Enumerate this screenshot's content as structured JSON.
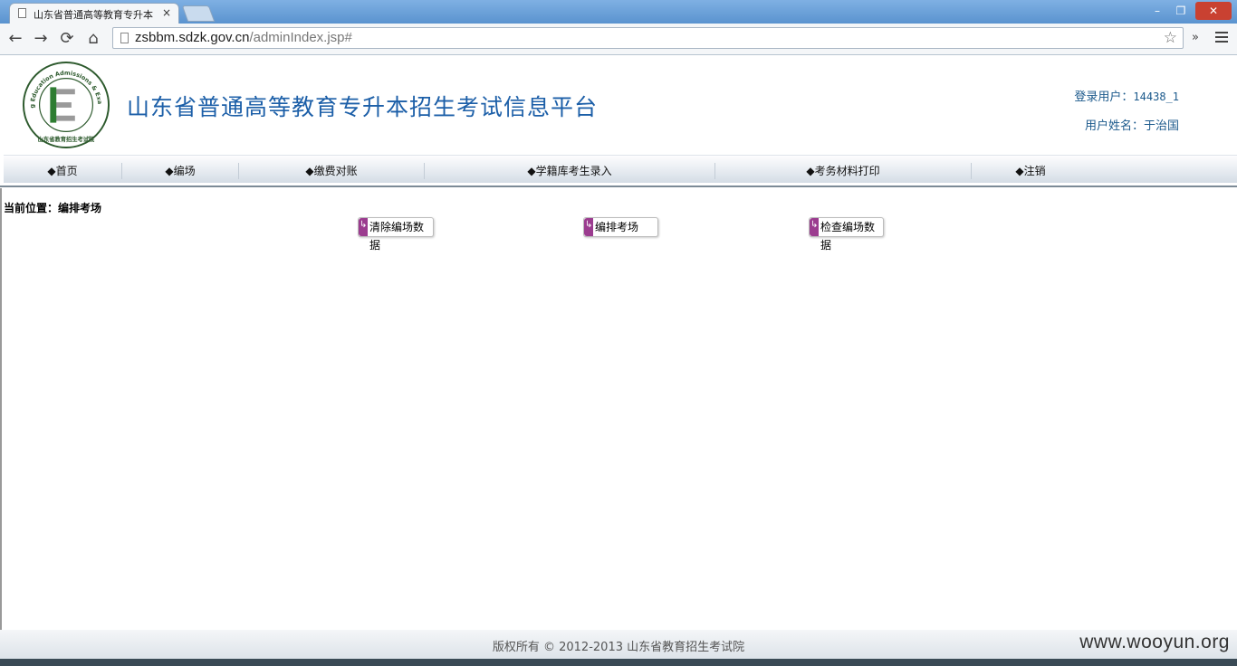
{
  "browser": {
    "tab_title": "山东省普通高等教育专升本",
    "tab_close": "×",
    "url_host": "zsbbm.sdzk.gov.cn",
    "url_path": "/adminIndex.jsp#",
    "back": "←",
    "forward": "→",
    "reload": "⟳",
    "home": "⌂",
    "star": "☆",
    "more": "»",
    "win_min": "–",
    "win_max": "❐",
    "win_close": "✕"
  },
  "header": {
    "site_title": "山东省普通高等教育专升本招生考试信息平台",
    "login_label": "登录用户：",
    "login_user": "14438_1",
    "name_label": "用户姓名：",
    "user_name": "于治国",
    "logo_ring_text": "Shandong Education Admissions & Examinations",
    "logo_bottom_text": "山东省教育招生考试院",
    "logo_letter": "E"
  },
  "nav": {
    "items": [
      {
        "label": "◆首页"
      },
      {
        "label": "◆编场"
      },
      {
        "label": "◆缴费对账"
      },
      {
        "label": "◆学籍库考生录入"
      },
      {
        "label": "◆考务材料打印"
      },
      {
        "label": "◆注销"
      }
    ]
  },
  "content": {
    "breadcrumb": "当前位置：编排考场",
    "buttons": [
      {
        "label": "清除编场数据"
      },
      {
        "label": "编排考场"
      },
      {
        "label": "检查编场数据"
      }
    ]
  },
  "footer": {
    "copyright": "版权所有 © 2012-2013 山东省教育招生考试院",
    "watermark": "www.wooyun.org"
  },
  "colors": {
    "title_blue": "#1c5fa8",
    "button_accent": "#9b3c8f",
    "close_red": "#c94131"
  }
}
